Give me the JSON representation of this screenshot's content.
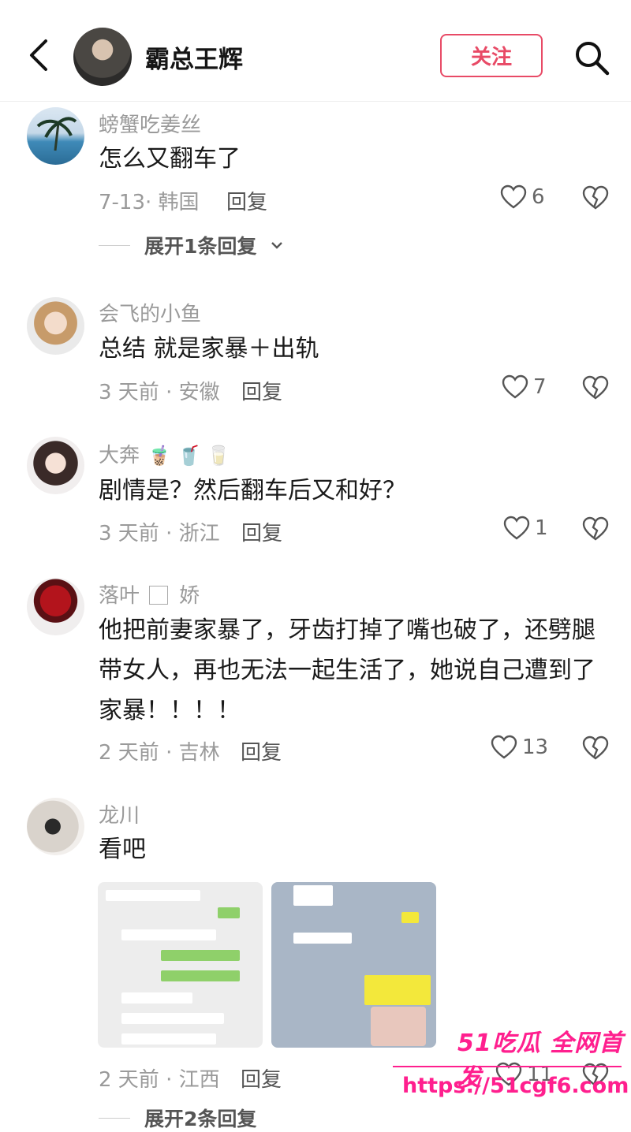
{
  "header": {
    "title": "霸总王辉",
    "follow_label": "关注"
  },
  "comments": [
    {
      "user": "螃蟹吃姜丝",
      "text": "怎么又翻车了",
      "date": "7-13· 韩国",
      "reply": "回复",
      "likes": "6",
      "expand": "展开1条回复"
    },
    {
      "user": "会飞的小鱼",
      "text": "总结 就是家暴＋出轨",
      "date": "3 天前 · 安徽",
      "reply": "回复",
      "likes": "7"
    },
    {
      "user": "大奔",
      "user_emojis": "🧋 🥤 🥛",
      "text": "剧情是？然后翻车后又和好？",
      "date": "3 天前 · 浙江",
      "reply": "回复",
      "likes": "1"
    },
    {
      "user_a": "落叶",
      "user_b": "娇",
      "text": "他把前妻家暴了，牙齿打掉了嘴也破了，还劈腿带女人，再也无法一起生活了，她说自己遭到了家暴！！！！",
      "date": "2 天前 · 吉林",
      "reply": "回复",
      "likes": "13"
    },
    {
      "user": "龙川",
      "text": "看吧",
      "date": "2 天前 · 江西",
      "reply": "回复",
      "likes": "11",
      "expand": "展开2条回复"
    }
  ],
  "watermark": {
    "line1": "51吃瓜 全网首发",
    "line2": "https://51cgf6.com"
  },
  "colors": {
    "accent": "#e84a66",
    "watermark": "#ff1f8e"
  }
}
